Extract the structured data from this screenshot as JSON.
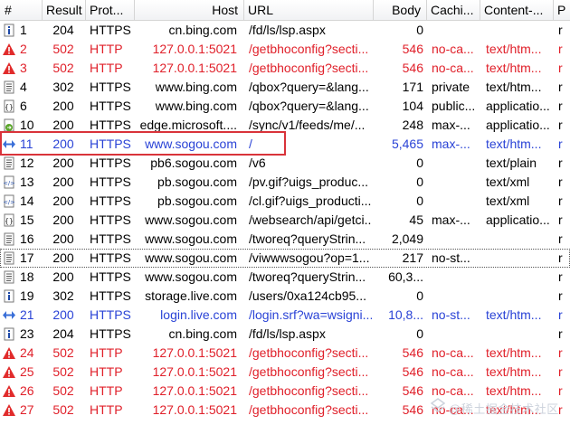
{
  "header": {
    "col_num": "#",
    "col_result": "Result",
    "col_protocol": "Prot...",
    "col_host": "Host",
    "col_url": "URL",
    "col_body": "Body",
    "col_caching": "Cachi...",
    "col_content": "Content-...",
    "col_extra": "P"
  },
  "colors": {
    "error": "#e0202a",
    "highlight": "#2a43d6",
    "selection_box": "#d9333a"
  },
  "rows": [
    {
      "icon": "info-icon",
      "num": "1",
      "result": "204",
      "protocol": "HTTPS",
      "host": "cn.bing.com",
      "url": "/fd/ls/lsp.aspx",
      "body": "0",
      "caching": "",
      "content_type": "",
      "extra": "r",
      "style": ""
    },
    {
      "icon": "warning-icon",
      "num": "2",
      "result": "502",
      "protocol": "HTTP",
      "host": "127.0.0.1:5021",
      "url": "/getbhoconfig?secti...",
      "body": "546",
      "caching": "no-ca...",
      "content_type": "text/htm...",
      "extra": "r",
      "style": "red"
    },
    {
      "icon": "warning-icon",
      "num": "3",
      "result": "502",
      "protocol": "HTTP",
      "host": "127.0.0.1:5021",
      "url": "/getbhoconfig?secti...",
      "body": "546",
      "caching": "no-ca...",
      "content_type": "text/htm...",
      "extra": "r",
      "style": "red"
    },
    {
      "icon": "document-icon",
      "num": "4",
      "result": "302",
      "protocol": "HTTPS",
      "host": "www.bing.com",
      "url": "/qbox?query=&lang...",
      "body": "171",
      "caching": "private",
      "content_type": "text/htm...",
      "extra": "r",
      "style": ""
    },
    {
      "icon": "script-icon",
      "num": "6",
      "result": "200",
      "protocol": "HTTPS",
      "host": "www.bing.com",
      "url": "/qbox?query=&lang...",
      "body": "104",
      "caching": "public...",
      "content_type": "applicatio...",
      "extra": "r",
      "style": ""
    },
    {
      "icon": "forward-icon",
      "num": "10",
      "result": "200",
      "protocol": "HTTPS",
      "host": "edge.microsoft....",
      "url": "/sync/v1/feeds/me/...",
      "body": "248",
      "caching": "max-...",
      "content_type": "applicatio...",
      "extra": "r",
      "style": ""
    },
    {
      "icon": "exchange-icon",
      "num": "11",
      "result": "200",
      "protocol": "HTTPS",
      "host": "www.sogou.com",
      "url": "/",
      "body": "5,465",
      "caching": "max-...",
      "content_type": "text/htm...",
      "extra": "r",
      "style": "blue"
    },
    {
      "icon": "document-icon",
      "num": "12",
      "result": "200",
      "protocol": "HTTPS",
      "host": "pb6.sogou.com",
      "url": "/v6",
      "body": "0",
      "caching": "",
      "content_type": "text/plain",
      "extra": "r",
      "style": ""
    },
    {
      "icon": "xml-icon",
      "num": "13",
      "result": "200",
      "protocol": "HTTPS",
      "host": "pb.sogou.com",
      "url": "/pv.gif?uigs_produc...",
      "body": "0",
      "caching": "",
      "content_type": "text/xml",
      "extra": "r",
      "style": ""
    },
    {
      "icon": "xml-icon",
      "num": "14",
      "result": "200",
      "protocol": "HTTPS",
      "host": "pb.sogou.com",
      "url": "/cl.gif?uigs_producti...",
      "body": "0",
      "caching": "",
      "content_type": "text/xml",
      "extra": "r",
      "style": ""
    },
    {
      "icon": "script-icon",
      "num": "15",
      "result": "200",
      "protocol": "HTTPS",
      "host": "www.sogou.com",
      "url": "/websearch/api/getci...",
      "body": "45",
      "caching": "max-...",
      "content_type": "applicatio...",
      "extra": "r",
      "style": ""
    },
    {
      "icon": "document-icon",
      "num": "16",
      "result": "200",
      "protocol": "HTTPS",
      "host": "www.sogou.com",
      "url": "/tworeq?queryStrin...",
      "body": "2,049",
      "caching": "",
      "content_type": "",
      "extra": "r",
      "style": ""
    },
    {
      "icon": "document-icon",
      "num": "17",
      "result": "200",
      "protocol": "HTTPS",
      "host": "www.sogou.com",
      "url": "/viwwwsogou?op=1...",
      "body": "217",
      "caching": "no-st...",
      "content_type": "",
      "extra": "r",
      "style": "dotted"
    },
    {
      "icon": "document-icon",
      "num": "18",
      "result": "200",
      "protocol": "HTTPS",
      "host": "www.sogou.com",
      "url": "/tworeq?queryStrin...",
      "body": "60,3...",
      "caching": "",
      "content_type": "",
      "extra": "r",
      "style": ""
    },
    {
      "icon": "info-icon",
      "num": "19",
      "result": "302",
      "protocol": "HTTPS",
      "host": "storage.live.com",
      "url": "/users/0xa124cb95...",
      "body": "0",
      "caching": "",
      "content_type": "",
      "extra": "r",
      "style": ""
    },
    {
      "icon": "exchange-icon",
      "num": "21",
      "result": "200",
      "protocol": "HTTPS",
      "host": "login.live.com",
      "url": "/login.srf?wa=wsigni...",
      "body": "10,8...",
      "caching": "no-st...",
      "content_type": "text/htm...",
      "extra": "r",
      "style": "blue"
    },
    {
      "icon": "info-icon",
      "num": "23",
      "result": "204",
      "protocol": "HTTPS",
      "host": "cn.bing.com",
      "url": "/fd/ls/lsp.aspx",
      "body": "0",
      "caching": "",
      "content_type": "",
      "extra": "r",
      "style": ""
    },
    {
      "icon": "warning-icon",
      "num": "24",
      "result": "502",
      "protocol": "HTTP",
      "host": "127.0.0.1:5021",
      "url": "/getbhoconfig?secti...",
      "body": "546",
      "caching": "no-ca...",
      "content_type": "text/htm...",
      "extra": "r",
      "style": "red"
    },
    {
      "icon": "warning-icon",
      "num": "25",
      "result": "502",
      "protocol": "HTTP",
      "host": "127.0.0.1:5021",
      "url": "/getbhoconfig?secti...",
      "body": "546",
      "caching": "no-ca...",
      "content_type": "text/htm...",
      "extra": "r",
      "style": "red"
    },
    {
      "icon": "warning-icon",
      "num": "26",
      "result": "502",
      "protocol": "HTTP",
      "host": "127.0.0.1:5021",
      "url": "/getbhoconfig?secti...",
      "body": "546",
      "caching": "no-ca...",
      "content_type": "text/htm...",
      "extra": "r",
      "style": "red"
    },
    {
      "icon": "warning-icon",
      "num": "27",
      "result": "502",
      "protocol": "HTTP",
      "host": "127.0.0.1:5021",
      "url": "/getbhoconfig?secti...",
      "body": "546",
      "caching": "no-ca...",
      "content_type": "text/htm...",
      "extra": "r",
      "style": "red"
    }
  ],
  "watermark": "@稀土掘金技术社区"
}
